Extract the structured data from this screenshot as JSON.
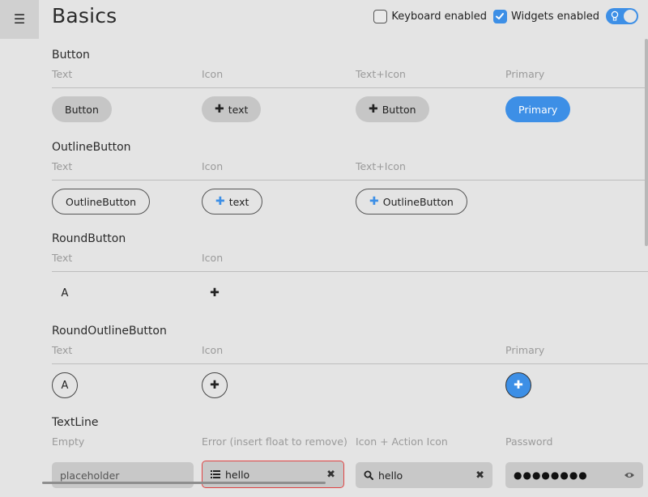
{
  "header": {
    "menu_icon": "hamburger-menu-icon",
    "title": "Basics",
    "keyboard_label": "Keyboard enabled",
    "widgets_label": "Widgets enabled",
    "keyboard_checked": false,
    "widgets_checked": true,
    "accent": "#3d8fe6"
  },
  "columns": {
    "text": "Text",
    "icon": "Icon",
    "text_icon": "Text+Icon",
    "primary": "Primary",
    "empty": "Empty",
    "error": "Error (insert float to remove)",
    "icon_action": "Icon + Action Icon",
    "password": "Password"
  },
  "sections": {
    "button": {
      "title": "Button",
      "text_label": "Button",
      "icon_label": "text",
      "text_icon_label": "Button",
      "primary_label": "Primary"
    },
    "outline_button": {
      "title": "OutlineButton",
      "text_label": "OutlineButton",
      "icon_label": "text",
      "text_icon_label": "OutlineButton"
    },
    "round_button": {
      "title": "RoundButton",
      "text_label": "A",
      "icon_label": "+"
    },
    "round_outline_button": {
      "title": "RoundOutlineButton",
      "text_label": "A",
      "icon_label": "+",
      "primary_label": "+"
    },
    "text_line": {
      "title": "TextLine",
      "empty_placeholder": "placeholder",
      "error_value": "hello",
      "icon_action_value": "hello",
      "password_dots": "●●●●●●●●",
      "clear_glyph": "✖",
      "plus_glyph": "+"
    }
  }
}
